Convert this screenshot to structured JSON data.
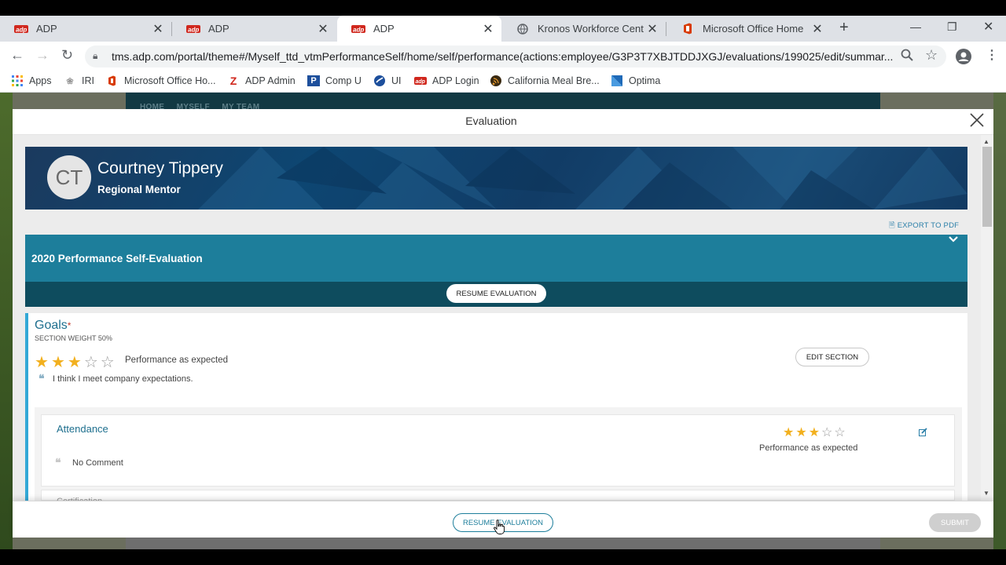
{
  "browser": {
    "tabs": [
      {
        "title": "ADP",
        "active": false
      },
      {
        "title": "ADP",
        "active": false
      },
      {
        "title": "ADP",
        "active": true
      },
      {
        "title": "Kronos Workforce Central(R",
        "active": false
      },
      {
        "title": "Microsoft Office Home",
        "active": false
      }
    ],
    "url": "tms.adp.com/portal/theme#/Myself_ttd_vtmPerformanceSelf/home/self/performance(actions:employee/G3P3T7XBJTDDJXGJ/evaluations/199025/edit/summar...",
    "bookmarks": [
      {
        "label": "Apps",
        "icon": "apps-grid-icon"
      },
      {
        "label": "IRI",
        "icon": "iri-icon"
      },
      {
        "label": "Microsoft Office Ho...",
        "icon": "office-icon"
      },
      {
        "label": "ADP Admin",
        "icon": "adp-admin-icon"
      },
      {
        "label": "Comp U",
        "icon": "comp-u-icon"
      },
      {
        "label": "UI",
        "icon": "ui-icon"
      },
      {
        "label": "ADP Login",
        "icon": "adp-icon"
      },
      {
        "label": "California Meal Bre...",
        "icon": "feed-icon"
      },
      {
        "label": "Optima",
        "icon": "optima-icon"
      }
    ]
  },
  "behind_nav": "HOME     MYSELF     MY TEAM",
  "modal": {
    "title": "Evaluation",
    "employee": {
      "initials": "CT",
      "name": "Courtney Tippery",
      "title": "Regional Mentor"
    },
    "export_label": "EXPORT TO PDF",
    "evaluation_title": "2020 Performance Self-Evaluation",
    "resume_label": "RESUME EVALUATION",
    "goals": {
      "title": "Goals",
      "required_mark": "*",
      "weight": "SECTION WEIGHT 50%",
      "rating_value": 3,
      "rating_max": 5,
      "rating_label": "Performance as expected",
      "comment": "I think I meet company expectations.",
      "edit_label": "EDIT SECTION"
    },
    "attendance": {
      "title": "Attendance",
      "rating_value": 3,
      "rating_max": 5,
      "rating_label": "Performance as expected",
      "comment": "No Comment"
    },
    "next_item_partial": "Certification",
    "footer": {
      "resume_label": "RESUME EVALUATION",
      "submit_label": "SUBMIT"
    }
  },
  "colors": {
    "teal": "#1d7e9b",
    "teal_dark": "#0e4c5e",
    "banner": "#0d4672",
    "star": "#f2b01e",
    "goals_accent": "#33a8d6"
  }
}
